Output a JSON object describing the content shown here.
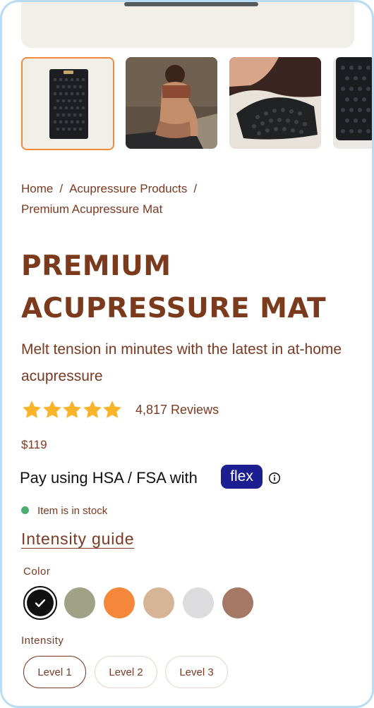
{
  "gallery": {
    "thumbnails": [
      {
        "alt": "mat-product-image"
      },
      {
        "alt": "woman-on-mat-image"
      },
      {
        "alt": "mat-closeup-image"
      },
      {
        "alt": "mat-detail-image"
      }
    ],
    "selected_index": 0
  },
  "breadcrumb": {
    "items": [
      "Home",
      "Acupressure Products",
      "Premium Acupressure Mat"
    ],
    "separator": "/"
  },
  "product": {
    "title_line1": "PREMIUM",
    "title_line2": "ACUPRESSURE MAT",
    "subtitle": "Melt tension in minutes with the latest in at-home acupressure",
    "rating": 5,
    "reviews": "4,817 Reviews",
    "price": "$119",
    "hsa_text": "Pay using HSA / FSA with",
    "hsa_badge": "flex",
    "stock_status": "Item is in stock",
    "intensity_guide": "Intensity guide"
  },
  "options": {
    "color_label": "Color",
    "colors": [
      "#111111",
      "#9fa285",
      "#f5873a",
      "#d6b596",
      "#dcdcde",
      "#a57866"
    ],
    "selected_color": 0,
    "intensity_label": "Intensity",
    "levels": [
      "Level 1",
      "Level 2",
      "Level 3"
    ],
    "selected_level": 0
  },
  "theme": {
    "brand": "#7c3a1d",
    "accent": "#f28a3c",
    "star": "#f9b42a",
    "badge": "#1c1f8f",
    "in_stock": "#4caf6e"
  }
}
